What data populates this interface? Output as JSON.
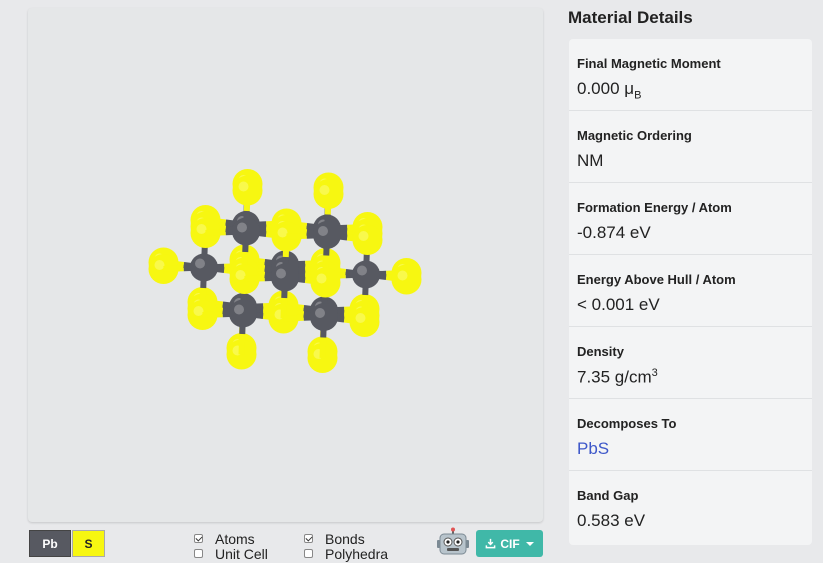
{
  "viewer": {
    "elements": [
      {
        "symbol": "Pb",
        "color": "#575961"
      },
      {
        "symbol": "S",
        "color": "#f7f711"
      }
    ],
    "toggles": {
      "atoms_label": "Atoms",
      "atoms_checked": true,
      "bonds_label": "Bonds",
      "bonds_checked": true,
      "unit_cell_label": "Unit Cell",
      "unit_cell_checked": false,
      "polyhedra_label": "Polyhedra",
      "polyhedra_checked": false
    },
    "robot_icon": "robot-icon",
    "export_button_label": "CIF",
    "export_icon": "download-icon"
  },
  "details": {
    "title": "Material Details",
    "items": [
      {
        "label": "Final Magnetic Moment",
        "value": "0.000 μ",
        "sub": "B"
      },
      {
        "label": "Magnetic Ordering",
        "value": "NM"
      },
      {
        "label": "Formation Energy / Atom",
        "value": "-0.874 eV"
      },
      {
        "label": "Energy Above Hull / Atom",
        "value": "< 0.001 eV"
      },
      {
        "label": "Density",
        "value": "7.35 g/cm",
        "sup": "3"
      },
      {
        "label": "Decomposes To",
        "value": "PbS"
      },
      {
        "label": "Band Gap",
        "value": "0.583 eV"
      }
    ]
  }
}
